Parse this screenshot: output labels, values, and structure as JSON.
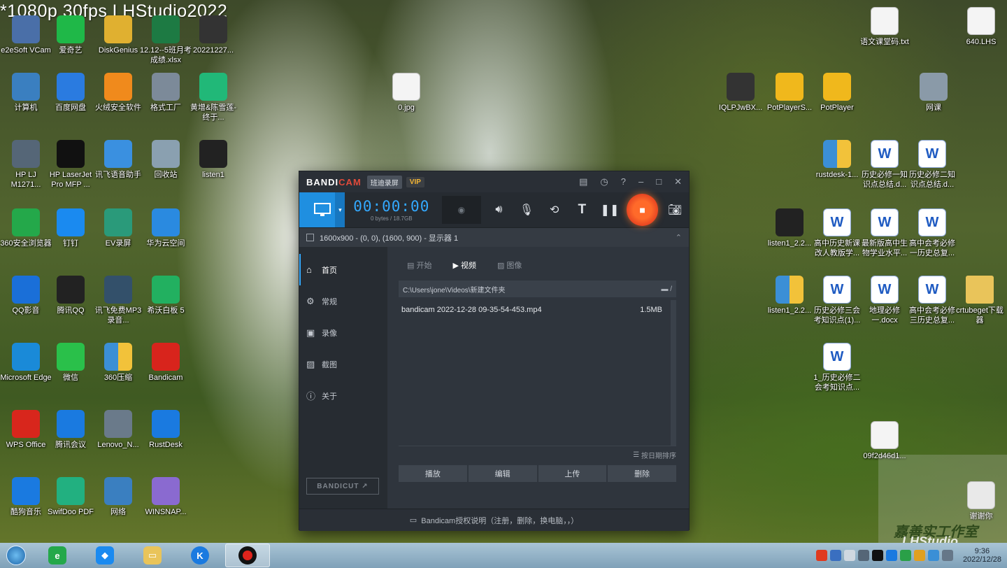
{
  "overlay": "*1080p 30fps LHStudio2022",
  "desktop_icons": [
    {
      "label": "e2eSoft VCam",
      "icon": "camera-icon",
      "color": "#4a6fa8"
    },
    {
      "label": "爱奇艺",
      "icon": "iqiyi-icon",
      "color": "#1fb848"
    },
    {
      "label": "DiskGenius",
      "icon": "disk-icon",
      "color": "#e0b030"
    },
    {
      "label": "12.12--5班月考成绩.xlsx",
      "icon": "excel-icon",
      "color": "#1d7a43"
    },
    {
      "label": "20221227...",
      "icon": "document-icon",
      "color": "#333333"
    },
    {
      "label": "计算机",
      "icon": "computer-icon",
      "color": "#3a7fc0"
    },
    {
      "label": "百度网盘",
      "icon": "baidu-netdisk-icon",
      "color": "#2a7be0"
    },
    {
      "label": "火绒安全软件",
      "icon": "shield-icon",
      "color": "#f08a1c"
    },
    {
      "label": "格式工厂",
      "icon": "format-factory-icon",
      "color": "#7c8a99"
    },
    {
      "label": "黄增&陈雪莲-终于...",
      "icon": "mp3-icon",
      "color": "#21b878"
    },
    {
      "label": "0.jpg",
      "icon": "image-icon",
      "color": "#dddddd"
    },
    {
      "label": "HP LJ M1271...",
      "icon": "printer-icon",
      "color": "#556677"
    },
    {
      "label": "HP LaserJet Pro MFP ...",
      "icon": "hp-icon",
      "color": "#111111"
    },
    {
      "label": "讯飞语音助手",
      "icon": "voice-icon",
      "color": "#3a90e0"
    },
    {
      "label": "回收站",
      "icon": "recycle-bin-icon",
      "color": "#8aa0b0"
    },
    {
      "label": "listen1",
      "icon": "listen1-icon",
      "color": "#222222"
    },
    {
      "label": "360安全浏览器",
      "icon": "browser-360-icon",
      "color": "#24a84a"
    },
    {
      "label": "钉钉",
      "icon": "dingtalk-icon",
      "color": "#1a8af0"
    },
    {
      "label": "EV录屏",
      "icon": "ev-recorder-icon",
      "color": "#2a9a7a"
    },
    {
      "label": "华为云空间",
      "icon": "cloud-icon",
      "color": "#2a8ae0"
    },
    {
      "label": "QQ影音",
      "icon": "qq-player-icon",
      "color": "#1a6fd8"
    },
    {
      "label": "腾讯QQ",
      "icon": "qq-icon",
      "color": "#222222"
    },
    {
      "label": "讯飞免费MP3录音...",
      "icon": "microphone-icon",
      "color": "#33506a"
    },
    {
      "label": "希沃白板 5",
      "icon": "seewo-icon",
      "color": "#22b060"
    },
    {
      "label": "Microsoft Edge",
      "icon": "edge-icon",
      "color": "#1a8ad8"
    },
    {
      "label": "微信",
      "icon": "wechat-icon",
      "color": "#2ac04a"
    },
    {
      "label": "360压缩",
      "icon": "zip-icon",
      "color": "#3a8fd6"
    },
    {
      "label": "Bandicam",
      "icon": "bandicam-icon",
      "color": "#d8241c"
    },
    {
      "label": "WPS Office",
      "icon": "wps-icon",
      "color": "#d8261c"
    },
    {
      "label": "腾讯会议",
      "icon": "tencent-meeting-icon",
      "color": "#1a7ae0"
    },
    {
      "label": "Lenovo_N...",
      "icon": "lenovo-icon",
      "color": "#6a7a8a"
    },
    {
      "label": "RustDesk",
      "icon": "rustdesk-icon",
      "color": "#1a7ae0"
    },
    {
      "label": "酷狗音乐",
      "icon": "kugou-icon",
      "color": "#1a7ae0"
    },
    {
      "label": "SwifDoo PDF",
      "icon": "pdf-icon",
      "color": "#22b080"
    },
    {
      "label": "网络",
      "icon": "network-icon",
      "color": "#3a7fc0"
    },
    {
      "label": "WINSNAP...",
      "icon": "winsnap-icon",
      "color": "#8a6ad0"
    },
    {
      "label": "语文课堂码.txt",
      "icon": "text-file-icon",
      "color": "#eeeeee"
    },
    {
      "label": "640.LHS",
      "icon": "file-icon",
      "color": "#eeeeee"
    },
    {
      "label": "IQLPJwBX...",
      "icon": "media-icon",
      "color": "#333333"
    },
    {
      "label": "PotPlayerS...",
      "icon": "potplayer-icon",
      "color": "#f0b81c"
    },
    {
      "label": "PotPlayer",
      "icon": "potplayer-icon",
      "color": "#f0b81c"
    },
    {
      "label": "网课",
      "icon": "drive-icon",
      "color": "#8a9aa8"
    },
    {
      "label": "rustdesk-1...",
      "icon": "zip-icon",
      "color": "#3a8fd6"
    },
    {
      "label": "历史必修一知识点总结.d...",
      "icon": "word-icon",
      "color": "#1f5bc2"
    },
    {
      "label": "历史必修二知识点总结.d...",
      "icon": "word-icon",
      "color": "#1f5bc2"
    },
    {
      "label": "listen1_2.2...",
      "icon": "listen1-icon",
      "color": "#222222"
    },
    {
      "label": "高中历史新课改人教版学...",
      "icon": "word-icon",
      "color": "#1f5bc2"
    },
    {
      "label": "最新版高中生物学业水平...",
      "icon": "word-icon",
      "color": "#1f5bc2"
    },
    {
      "label": "高中会考必修一历史总复...",
      "icon": "word-icon",
      "color": "#1f5bc2"
    },
    {
      "label": "listen1_2.2...",
      "icon": "zip-icon",
      "color": "#3a8fd6"
    },
    {
      "label": "历史必修三会考知识点(1)...",
      "icon": "word-icon",
      "color": "#1f5bc2"
    },
    {
      "label": "地理必修一.docx",
      "icon": "word-icon",
      "color": "#1f5bc2"
    },
    {
      "label": "高中会考必修三历史总复...",
      "icon": "word-icon",
      "color": "#1f5bc2"
    },
    {
      "label": "crtubeget下载器",
      "icon": "folder-icon",
      "color": "#e9c45a"
    },
    {
      "label": "1_历史必修二会考知识点...",
      "icon": "word-icon",
      "color": "#1f5bc2"
    },
    {
      "label": "09f2d46d1...",
      "icon": "image-icon",
      "color": "#cccccc"
    },
    {
      "label": "谢谢你",
      "icon": "file-icon",
      "color": "#eeeeee"
    }
  ],
  "bandicam": {
    "logo_a": "BANDI",
    "logo_b": "CAM",
    "tag": "班迪录屏",
    "vip": "VIP",
    "timer": "00:00:00",
    "size": "0 bytes / 18.7GB",
    "region": "1600x900 - (0, 0), (1600, 900) - 显示器 1",
    "sidebar": [
      "首页",
      "常规",
      "录像",
      "截图",
      "关于"
    ],
    "tabs": [
      "开始",
      "视频",
      "图像"
    ],
    "path": "C:\\Users\\jone\\Videos\\新建文件夹",
    "path_suffix": "/",
    "file_name": "bandicam 2022-12-28 09-35-54-453.mp4",
    "file_size": "1.5MB",
    "sort_label": "按日期排序",
    "actions": [
      "播放",
      "编辑",
      "上传",
      "删除"
    ],
    "bandicut": "BANDICUT",
    "footer": "Bandicam授权说明（注册，删除，换电脑，，）"
  },
  "taskbar": {
    "clock_time": "9:36",
    "clock_date": "2022/12/28"
  },
  "watermark": {
    "line1": "嘉善实工作室",
    "line2": "LHStudio"
  }
}
